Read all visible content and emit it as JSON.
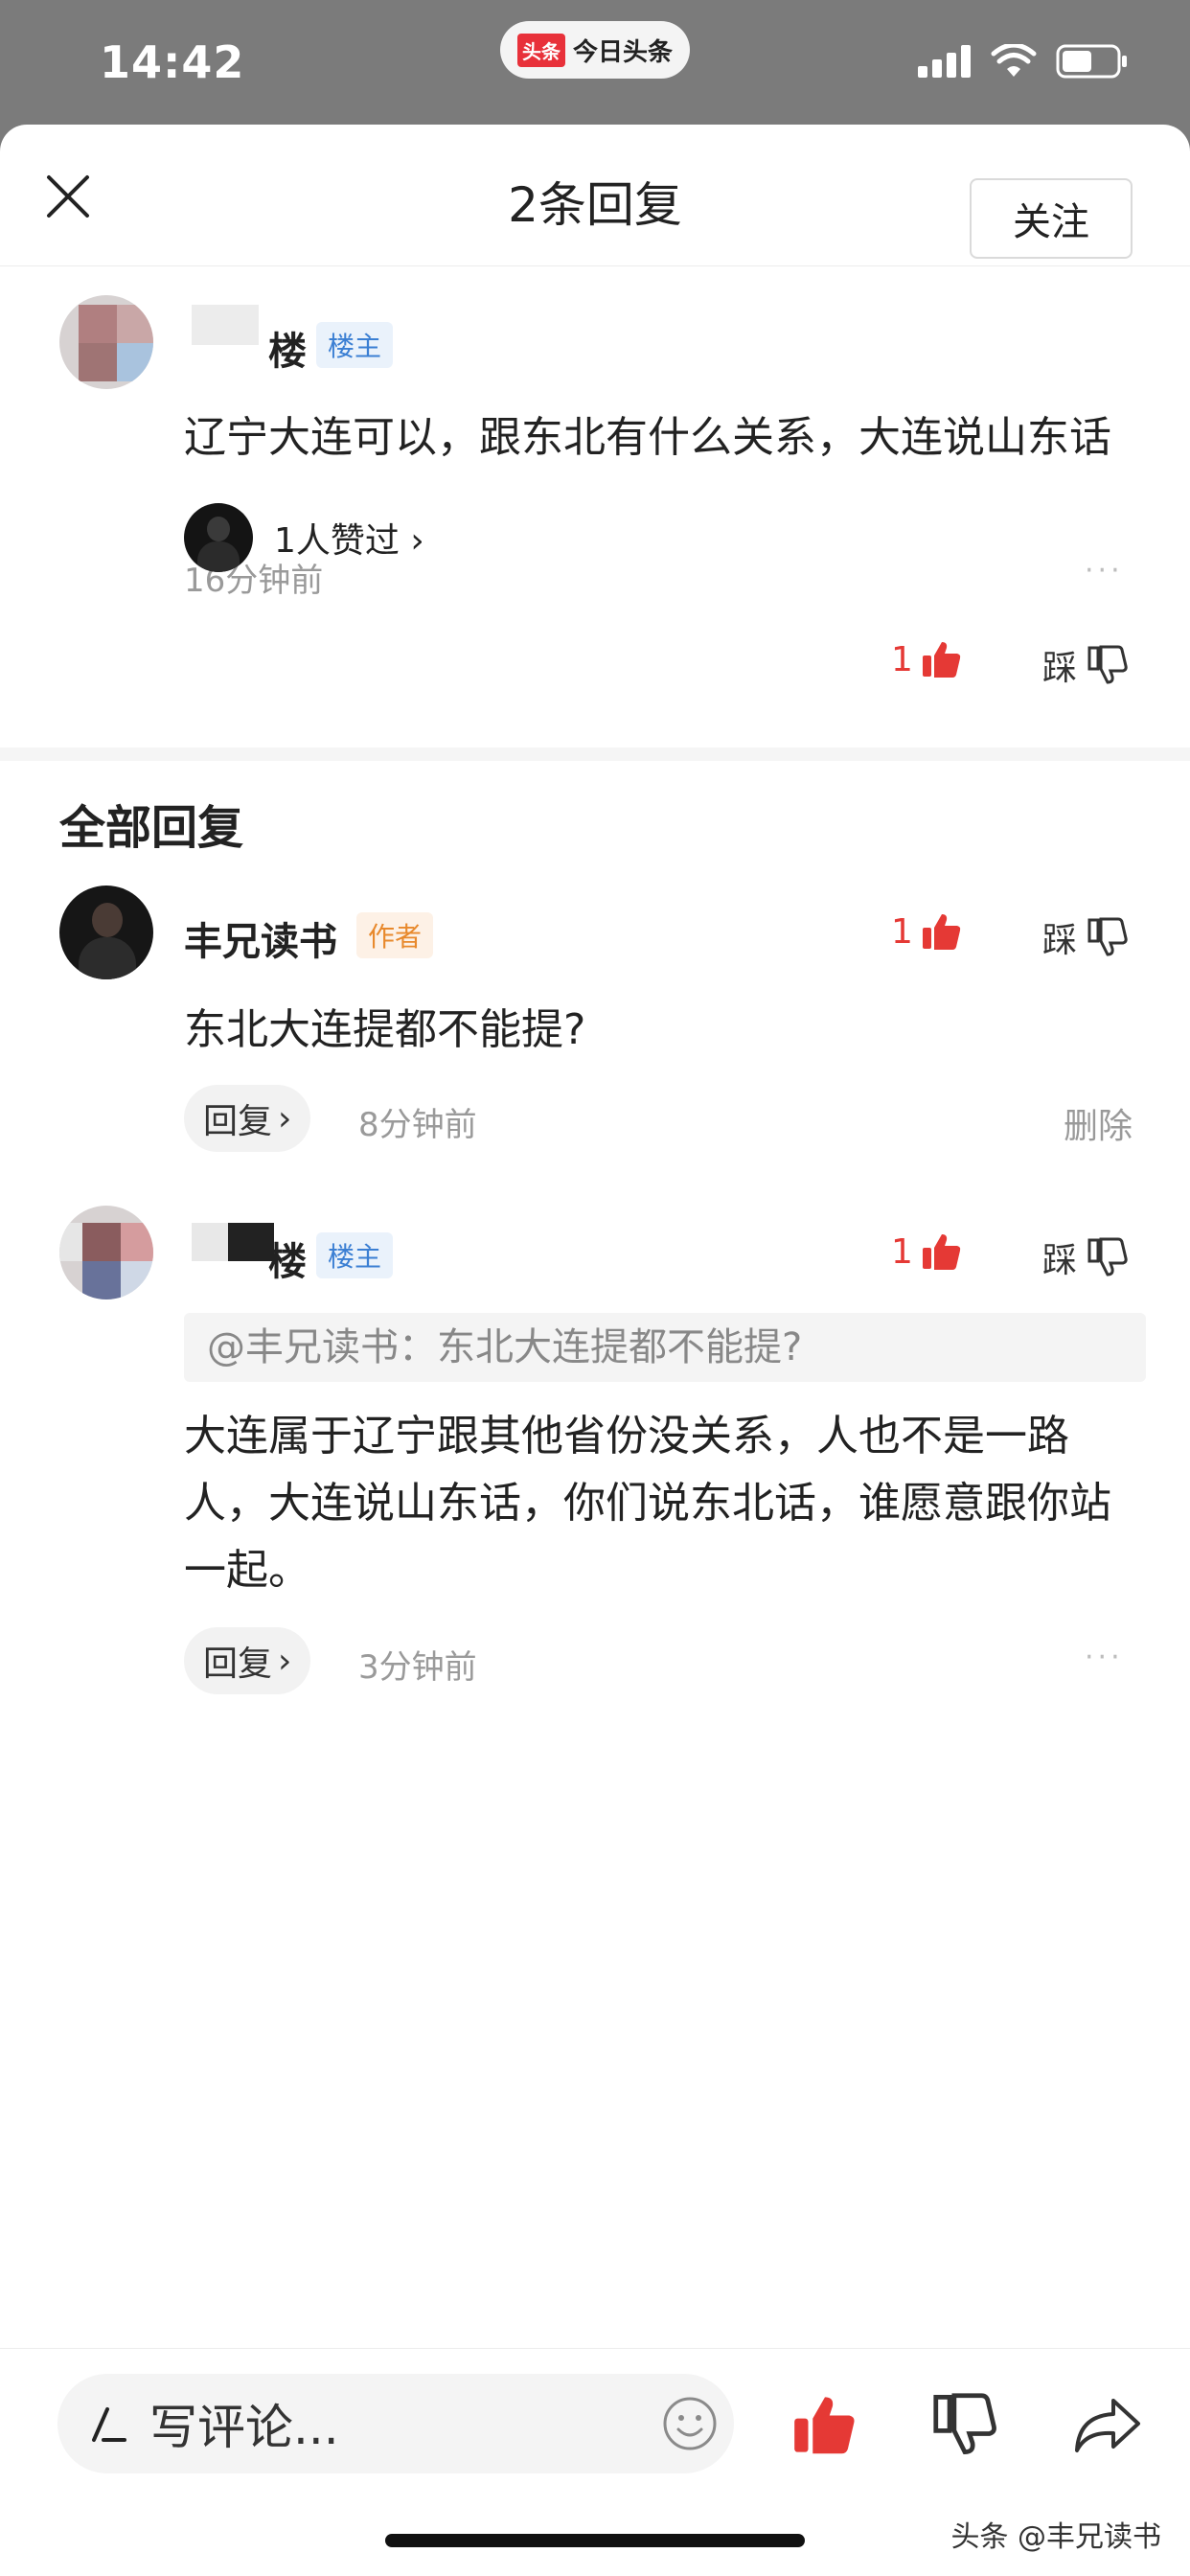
{
  "status_bar": {
    "time": "14:42",
    "app_logo": "头条",
    "app_name": "今日头条"
  },
  "header": {
    "title": "2条回复"
  },
  "op": {
    "name": "楼",
    "tag": "楼主",
    "follow_label": "关注",
    "content": "辽宁大连可以，跟东北有什么关系，大连说山东话",
    "time": "16分钟前",
    "more": "···",
    "likers": "1人赞过 ›",
    "like_count": "1",
    "dislike_label": "踩"
  },
  "section": {
    "title": "全部回复"
  },
  "replies": [
    {
      "name": "丰兄读书",
      "tag": "作者",
      "like_count": "1",
      "dislike_label": "踩",
      "content": "东北大连提都不能提?",
      "reply_label": "回复",
      "time": "8分钟前",
      "delete_label": "删除"
    },
    {
      "name": "楼",
      "tag": "楼主",
      "like_count": "1",
      "dislike_label": "踩",
      "quote": "@丰兄读书：东北大连提都不能提?",
      "content": "大连属于辽宁跟其他省份没关系，人也不是一路人，大连说山东话，你们说东北话，谁愿意跟你站一起。",
      "reply_label": "回复",
      "time": "3分钟前",
      "more": "···"
    }
  ],
  "bottom_bar": {
    "comment_placeholder": "写评论..."
  },
  "watermark": "头条 @丰兄读书",
  "colors": {
    "accent_red": "#e53935",
    "tag_blue": "#3b7fd3",
    "tag_orange": "#e8892c"
  }
}
